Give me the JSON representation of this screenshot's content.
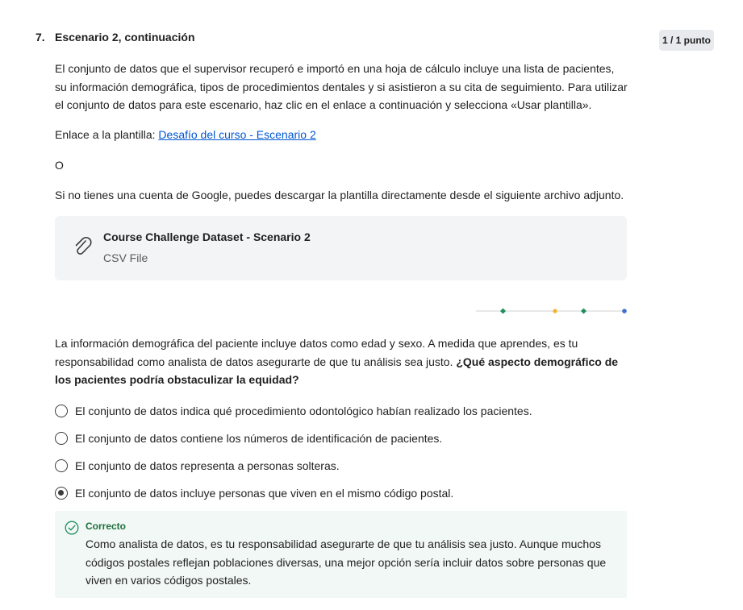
{
  "question": {
    "number": "7.",
    "title": "Escenario 2, continuación",
    "points": "1 / 1 punto"
  },
  "intro": {
    "paragraph": "El conjunto de datos que el supervisor recuperó e importó en una hoja de cálculo incluye una lista de pacientes, su información demográfica, tipos de procedimientos dentales y si asistieron a su cita de seguimiento. Para utilizar el conjunto de datos para este escenario, haz clic en el enlace a continuación y selecciona «Usar plantilla».",
    "template_prefix": "Enlace a la plantilla: ",
    "template_link": "Desafío del curso - Escenario 2",
    "or_text": "O",
    "download_text": "Si no tienes una cuenta de Google, puedes descargar la plantilla directamente desde el siguiente archivo adjunto."
  },
  "attachment": {
    "icon": "paperclip-icon",
    "title": "Course Challenge Dataset - Scenario 2",
    "subtitle": "CSV File"
  },
  "divider_colors": [
    "#1e8f5e",
    "#f0b429",
    "#1e8f5e",
    "#3d6fcf"
  ],
  "prompt": {
    "text": "La información demográfica del paciente incluye datos como edad y sexo. A medida que aprendes, es tu responsabilidad como analista de datos asegurarte de que tu análisis sea justo. ",
    "bold_text": "¿Qué aspecto demográfico de los pacientes podría obstaculizar la equidad?"
  },
  "options": [
    {
      "label": "El conjunto de datos indica qué procedimiento odontológico habían realizado los pacientes.",
      "selected": false
    },
    {
      "label": "El conjunto de datos contiene los números de identificación de pacientes.",
      "selected": false
    },
    {
      "label": "El conjunto de datos representa a personas solteras.",
      "selected": false
    },
    {
      "label": "El conjunto de datos incluye personas que viven en el mismo código postal.",
      "selected": true
    }
  ],
  "feedback": {
    "icon": "check-circle-icon",
    "title": "Correcto",
    "text": "Como analista de datos, es tu responsabilidad asegurarte de que tu análisis sea justo. Aunque muchos códigos postales reflejan poblaciones diversas, una mejor opción sería incluir datos sobre personas que viven en varios códigos postales."
  }
}
